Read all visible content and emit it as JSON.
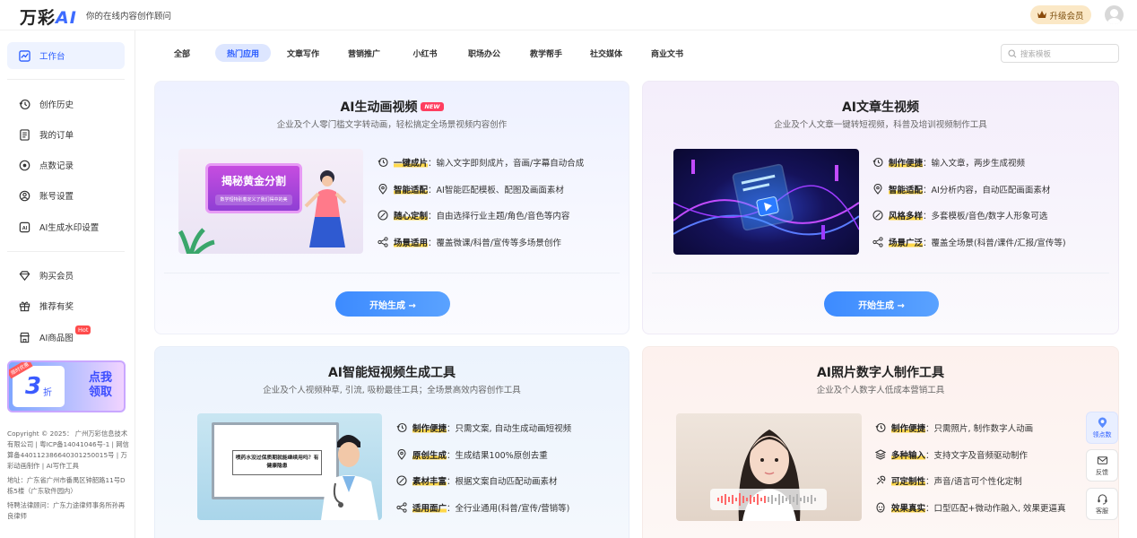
{
  "header": {
    "logo_text": "万彩",
    "logo_ai": "AI",
    "slogan": "你的在线内容创作顾问",
    "upgrade_label": "升级会员"
  },
  "sidebar": {
    "items": [
      {
        "label": "工作台",
        "icon": "dashboard-icon",
        "active": true
      },
      {
        "label": "创作历史",
        "icon": "history-icon"
      },
      {
        "label": "我的订单",
        "icon": "order-icon"
      },
      {
        "label": "点数记录",
        "icon": "points-icon"
      },
      {
        "label": "账号设置",
        "icon": "account-icon"
      },
      {
        "label": "AI生成水印设置",
        "icon": "watermark-icon"
      },
      {
        "label": "购买会员",
        "icon": "diamond-icon"
      },
      {
        "label": "推荐有奖",
        "icon": "gift-icon"
      },
      {
        "label": "AI商品图",
        "icon": "shop-icon",
        "badge": "Hot"
      }
    ],
    "promo": {
      "tag": "限时优惠",
      "num": "3",
      "unit": "折",
      "right_line1": "点我",
      "right_line2": "领取"
    },
    "copyright": "Copyright © 2025： 广州万彩信息技术有限公司 | 粤ICP备14041046号-1 | 网信算备440112386640301250015号 | 万彩动画制作 | AI写作工具",
    "address": "地址：广东省广州市番禺区钟韶路11号D栋5楼（广东软件园内）",
    "legal": "特聘法律顾问：广东力途律师事务所孙再良律师"
  },
  "tabs": [
    "全部",
    "热门应用",
    "文章写作",
    "营销推广",
    "小红书",
    "职场办公",
    "教学帮手",
    "社交媒体",
    "商业文书"
  ],
  "active_tab": "热门应用",
  "search": {
    "placeholder": "搜索模板"
  },
  "cards": [
    {
      "title": "AI生动画视频",
      "badge": "NEW",
      "subtitle": "企业及个人零门槛文字转动画，轻松搞定全场景视频内容创作",
      "image_text": {
        "banner": "揭秘黄金分割",
        "sub": "数学短特别着定义了我们得中的美"
      },
      "features": [
        {
          "kw": "一键成片",
          "text": "输入文字即刻成片，音画/字幕自动合成",
          "icon": "timer-icon"
        },
        {
          "kw": "智能适配",
          "text": "AI智能匹配模板、配图及画面素材",
          "icon": "location-icon"
        },
        {
          "kw": "随心定制",
          "text": "自由选择行业主题/角色/音色等内容",
          "icon": "edit-icon"
        },
        {
          "kw": "场景适用",
          "text": "覆盖微课/科普/宣传等多场景创作",
          "icon": "share-icon"
        }
      ],
      "cta": "开始生成 →"
    },
    {
      "title": "AI文章生视频",
      "subtitle": "企业及个人文章一键转短视频，科普及培训视频制作工具",
      "features": [
        {
          "kw": "制作便捷",
          "text": "输入文章，两步生成视频",
          "icon": "timer-icon"
        },
        {
          "kw": "智能适配",
          "text": "AI分析内容，自动匹配画面素材",
          "icon": "location-icon"
        },
        {
          "kw": "风格多样",
          "text": "多套模板/音色/数字人形象可选",
          "icon": "edit-icon"
        },
        {
          "kw": "场景广泛",
          "text": "覆盖全场景(科普/课件/汇报/宣传等)",
          "icon": "share-icon"
        }
      ],
      "cta": "开始生成 →"
    },
    {
      "title": "AI智能短视频生成工具",
      "subtitle": "企业及个人视频种草, 引流, 吸粉最佳工具；全场景高效内容创作工具",
      "image_text": {
        "board": "喷药水没过保质期就能继续用吗？有健康隐患"
      },
      "features": [
        {
          "kw": "制作便捷",
          "text": "只需文案, 自动生成动画短视频",
          "icon": "timer-icon"
        },
        {
          "kw": "原创生成",
          "text": "生成结果100%原创去重",
          "icon": "location-icon"
        },
        {
          "kw": "素材丰富",
          "text": "根据文案自动匹配动画素材",
          "icon": "edit-icon"
        },
        {
          "kw": "适用面广",
          "text": "全行业通用(科普/宣传/营销等)",
          "icon": "share-icon"
        }
      ]
    },
    {
      "title": "AI照片数字人制作工具",
      "subtitle": "企业及个人数字人低成本营销工具",
      "features": [
        {
          "kw": "制作便捷",
          "text": "只需照片, 制作数字人动画",
          "icon": "timer-icon"
        },
        {
          "kw": "多种输入",
          "text": "支持文字及音频驱动制作",
          "icon": "layers-icon"
        },
        {
          "kw": "可定制性",
          "text": "声音/语言可个性化定制",
          "icon": "custom-icon"
        },
        {
          "kw": "效果真实",
          "text": "口型匹配+微动作融入, 效果更逼真",
          "icon": "face-icon"
        }
      ]
    }
  ],
  "float": {
    "points": "领点数",
    "feedback": "反馈",
    "service": "客服"
  }
}
